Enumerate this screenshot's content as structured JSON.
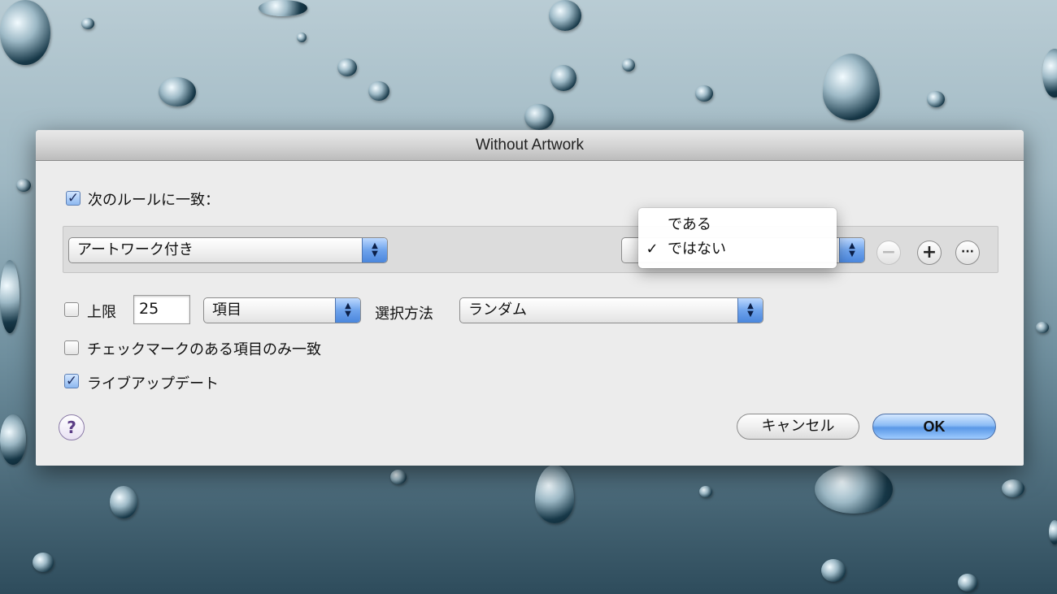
{
  "window": {
    "title": "Without Artwork"
  },
  "match_rules": {
    "checked": true,
    "label": "次のルールに一致："
  },
  "rule": {
    "field_popup": "アートワーク付き",
    "operator_menu": {
      "options": [
        "である",
        "ではない"
      ],
      "selected_index": 1,
      "check_glyph": "✓"
    }
  },
  "limit": {
    "checked": false,
    "label": "上限",
    "value": "25",
    "unit_popup": "項目",
    "selection_label": "選択方法",
    "selection_popup": "ランダム"
  },
  "checked_only": {
    "checked": false,
    "label": "チェックマークのある項目のみ一致"
  },
  "live_update": {
    "checked": true,
    "label": "ライブアップデート"
  },
  "buttons": {
    "cancel": "キャンセル",
    "ok": "OK",
    "help": "?",
    "minus": "−",
    "plus": "+",
    "more": "···"
  },
  "colors": {
    "accent": "#5a98e6",
    "help_purple": "#5b3d86"
  }
}
